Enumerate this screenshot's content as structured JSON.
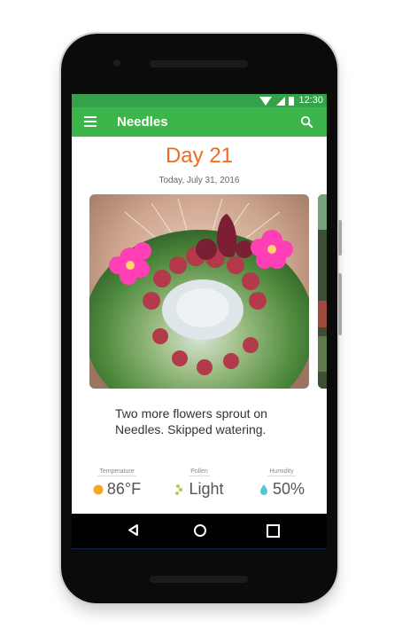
{
  "status_bar": {
    "time": "12:30"
  },
  "app_bar": {
    "title": "Needles"
  },
  "entry": {
    "day": "Day 21",
    "date": "Today, July 31, 2016",
    "caption": "Two more flowers sprout on Needles. Skipped watering."
  },
  "stats": {
    "temperature": {
      "label": "Temperature",
      "value": "86°F"
    },
    "pollen": {
      "label": "Pollen",
      "value": "Light"
    },
    "humidity": {
      "label": "Humidity",
      "value": "50%"
    }
  },
  "colors": {
    "status_bar": "#33a24a",
    "app_bar": "#3cb64a",
    "accent": "#f26a21"
  },
  "icons": {
    "menu": "menu-icon",
    "search": "search-icon",
    "temperature": "sun-dot-icon",
    "pollen": "pollen-icon",
    "humidity": "water-drop-icon"
  }
}
